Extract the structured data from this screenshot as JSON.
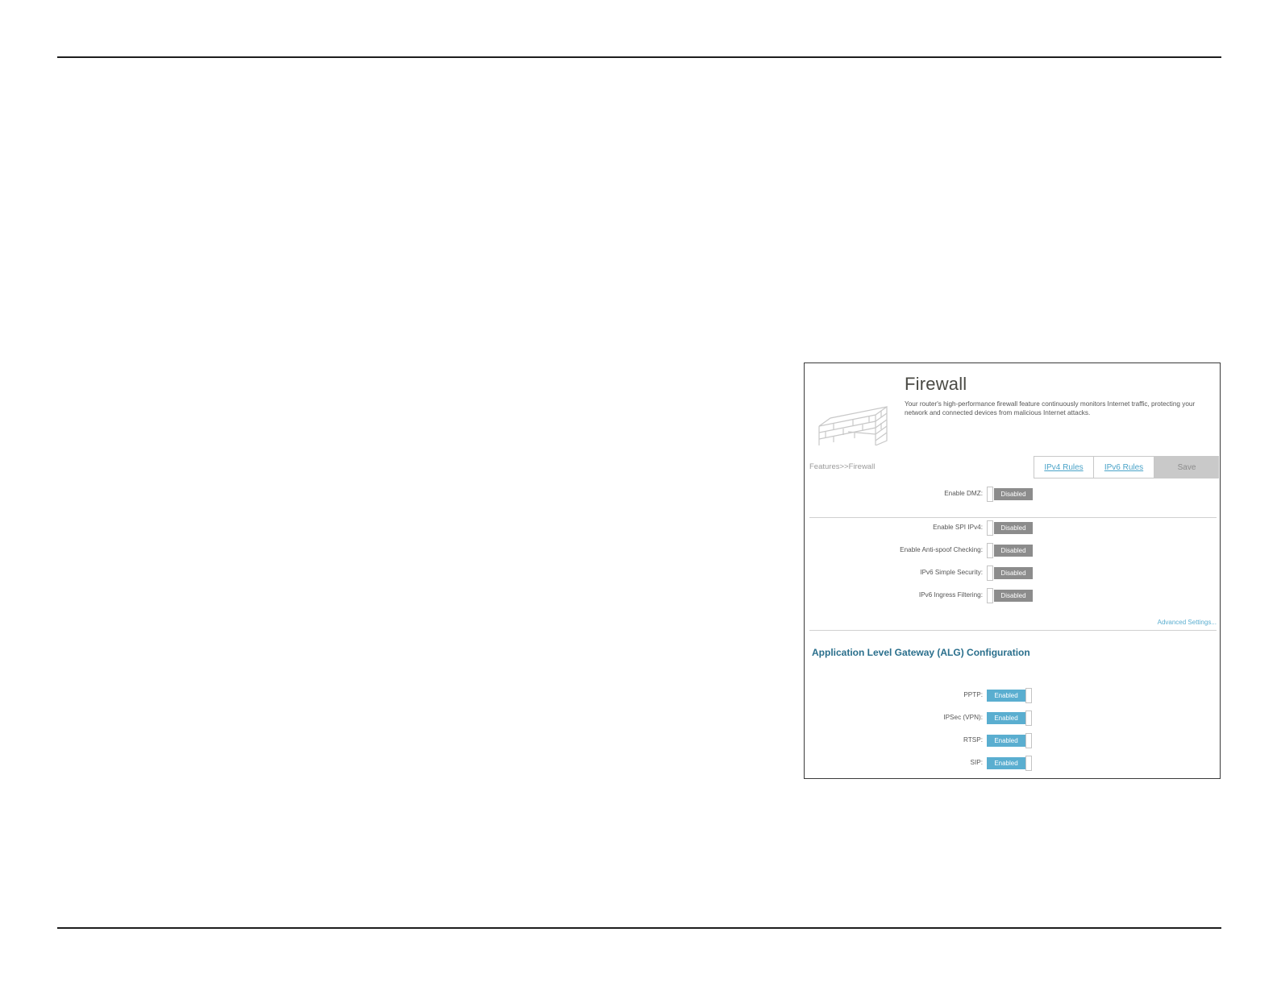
{
  "page": {
    "title": "Firewall",
    "description": "Your router's high-performance firewall feature continuously monitors Internet traffic, protecting your network and connected devices from malicious Internet attacks.",
    "breadcrumb": "Features>>Firewall"
  },
  "toolbar": {
    "ipv4_rules": "IPv4 Rules",
    "ipv6_rules": "IPv6 Rules",
    "save": "Save"
  },
  "firewall_settings": [
    {
      "label": "Enable DMZ:",
      "state": "Disabled"
    },
    {
      "label": "Enable SPI IPv4:",
      "state": "Disabled"
    },
    {
      "label": "Enable Anti-spoof Checking:",
      "state": "Disabled"
    },
    {
      "label": "IPv6 Simple Security:",
      "state": "Disabled"
    },
    {
      "label": "IPv6 Ingress Filtering:",
      "state": "Disabled"
    }
  ],
  "advanced_link": "Advanced Settings...",
  "alg": {
    "heading": "Application Level Gateway (ALG) Configuration",
    "items": [
      {
        "label": "PPTP:",
        "state": "Enabled"
      },
      {
        "label": "IPSec (VPN):",
        "state": "Enabled"
      },
      {
        "label": "RTSP:",
        "state": "Enabled"
      },
      {
        "label": "SIP:",
        "state": "Enabled"
      }
    ]
  },
  "icons": {
    "header_graphic": "brick-wall-icon"
  },
  "colors": {
    "enabled": "#5aaed0",
    "disabled": "#8c8c8c",
    "link": "#4aa3c8",
    "heading": "#2a6f8c"
  }
}
